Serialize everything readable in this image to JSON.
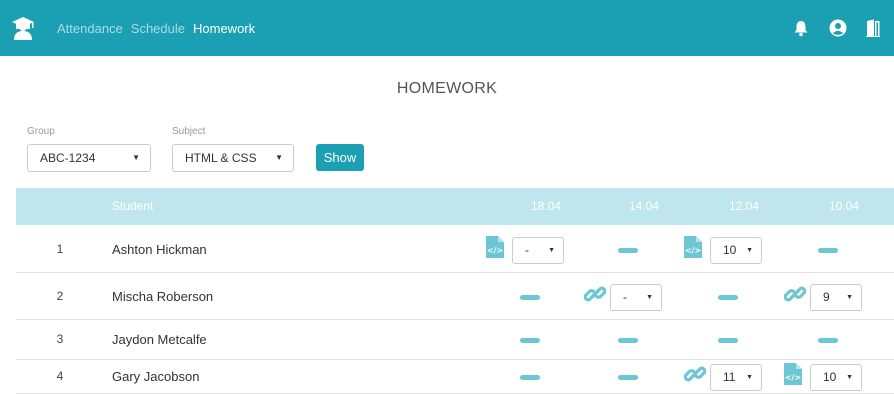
{
  "nav": {
    "items": [
      "Attendance",
      "Schedule",
      "Homework"
    ],
    "active": 2
  },
  "page": {
    "title": "HOMEWORK"
  },
  "filters": {
    "group_label": "Group",
    "group_value": "ABC-1234",
    "subject_label": "Subject",
    "subject_value": "HTML & CSS",
    "show_label": "Show"
  },
  "table": {
    "headers": {
      "student": "Student",
      "dates": [
        "18.04",
        "14.04",
        "12.04",
        "10.04"
      ]
    },
    "rows": [
      {
        "num": "1",
        "name": "Ashton Hickman",
        "cells": [
          {
            "kind": "file",
            "grade": "-"
          },
          {
            "kind": "none"
          },
          {
            "kind": "file",
            "grade": "10"
          },
          {
            "kind": "none"
          }
        ]
      },
      {
        "num": "2",
        "name": "Mischa Roberson",
        "cells": [
          {
            "kind": "none"
          },
          {
            "kind": "link",
            "grade": "-"
          },
          {
            "kind": "none"
          },
          {
            "kind": "link",
            "grade": "9"
          }
        ]
      },
      {
        "num": "3",
        "name": "Jaydon Metcalfe",
        "cells": [
          {
            "kind": "none"
          },
          {
            "kind": "none"
          },
          {
            "kind": "none"
          },
          {
            "kind": "none"
          }
        ]
      },
      {
        "num": "4",
        "name": "Gary Jacobson",
        "cells": [
          {
            "kind": "none"
          },
          {
            "kind": "none"
          },
          {
            "kind": "link",
            "grade": "11"
          },
          {
            "kind": "file",
            "grade": "10"
          }
        ]
      }
    ]
  },
  "icons": {
    "logo": "graduate-icon",
    "notifications": "bell-icon",
    "profile": "user-circle-icon",
    "logout": "door-exit-icon",
    "file": "code-file-icon",
    "link": "link-icon"
  },
  "colors": {
    "brand": "#1b9fb2",
    "header_row": "#bfe6ec",
    "accent": "#6dc6d4"
  }
}
